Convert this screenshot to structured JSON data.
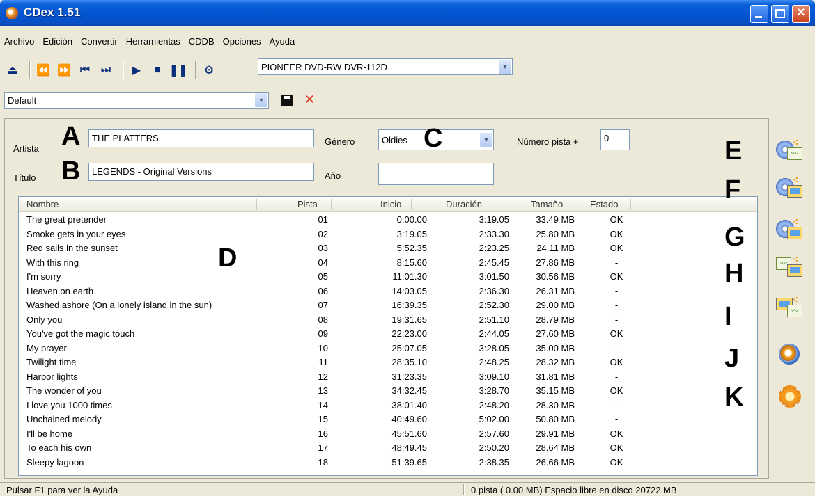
{
  "window": {
    "title": "CDex 1.51"
  },
  "menu": [
    "Archivo",
    "Edición",
    "Convertir",
    "Herramientas",
    "CDDB",
    "Opciones",
    "Ayuda"
  ],
  "toolbar": {
    "drive": "PIONEER DVD-RW  DVR-112D"
  },
  "profile": {
    "value": "Default"
  },
  "fields": {
    "artist_label": "Artista",
    "artist": "THE PLATTERS",
    "title_label": "Título",
    "title": "LEGENDS - Original Versions",
    "genre_label": "Género",
    "genre": "Oldies",
    "year_label": "Año",
    "year": "",
    "track_offset_label": "Número pista +",
    "track_offset": "0"
  },
  "letters": {
    "A": "A",
    "B": "B",
    "C": "C",
    "D": "D",
    "E": "E",
    "F": "F",
    "G": "G",
    "H": "H",
    "I": "I",
    "J": "J",
    "K": "K"
  },
  "table": {
    "columns": [
      "Nombre",
      "Pista",
      "Inicio",
      "Duración",
      "Tamaño",
      "Estado"
    ],
    "rows": [
      [
        "The great pretender",
        "01",
        "0:00.00",
        "3:19.05",
        "33.49 MB",
        "OK"
      ],
      [
        "Smoke gets in your eyes",
        "02",
        "3:19.05",
        "2:33.30",
        "25.80 MB",
        "OK"
      ],
      [
        "Red sails in the sunset",
        "03",
        "5:52.35",
        "2:23.25",
        "24.11 MB",
        "OK"
      ],
      [
        "With this ring",
        "04",
        "8:15.60",
        "2:45.45",
        "27.86 MB",
        "-"
      ],
      [
        "I'm sorry",
        "05",
        "11:01.30",
        "3:01.50",
        "30.56 MB",
        "OK"
      ],
      [
        "Heaven on earth",
        "06",
        "14:03.05",
        "2:36.30",
        "26.31 MB",
        "-"
      ],
      [
        "Washed ashore (On a lonely island in the sun)",
        "07",
        "16:39.35",
        "2:52.30",
        "29.00 MB",
        "-"
      ],
      [
        "Only you",
        "08",
        "19:31.65",
        "2:51.10",
        "28.79 MB",
        "-"
      ],
      [
        "You've got the magic touch",
        "09",
        "22:23.00",
        "2:44.05",
        "27.60 MB",
        "OK"
      ],
      [
        "My prayer",
        "10",
        "25:07.05",
        "3:28.05",
        "35.00 MB",
        "-"
      ],
      [
        "Twilight time",
        "11",
        "28:35.10",
        "2:48.25",
        "28.32 MB",
        "OK"
      ],
      [
        "Harbor lights",
        "12",
        "31:23.35",
        "3:09.10",
        "31.81 MB",
        "-"
      ],
      [
        "The wonder of you",
        "13",
        "34:32.45",
        "3:28.70",
        "35.15 MB",
        "OK"
      ],
      [
        "I love you 1000 times",
        "14",
        "38:01.40",
        "2:48.20",
        "28.30 MB",
        "-"
      ],
      [
        "Unchained melody",
        "15",
        "40:49.60",
        "5:02.00",
        "50.80 MB",
        "-"
      ],
      [
        "I'll be home",
        "16",
        "45:51.60",
        "2:57.60",
        "29.91 MB",
        "OK"
      ],
      [
        "To each his own",
        "17",
        "48:49.45",
        "2:50.20",
        "28.64 MB",
        "OK"
      ],
      [
        "Sleepy lagoon",
        "18",
        "51:39.65",
        "2:38.35",
        "26.66 MB",
        "OK"
      ]
    ]
  },
  "status": {
    "left": "Pulsar F1 para ver la Ayuda",
    "right": "0 pista ( 0.00 MB) Espacio libre en disco 20722 MB"
  }
}
